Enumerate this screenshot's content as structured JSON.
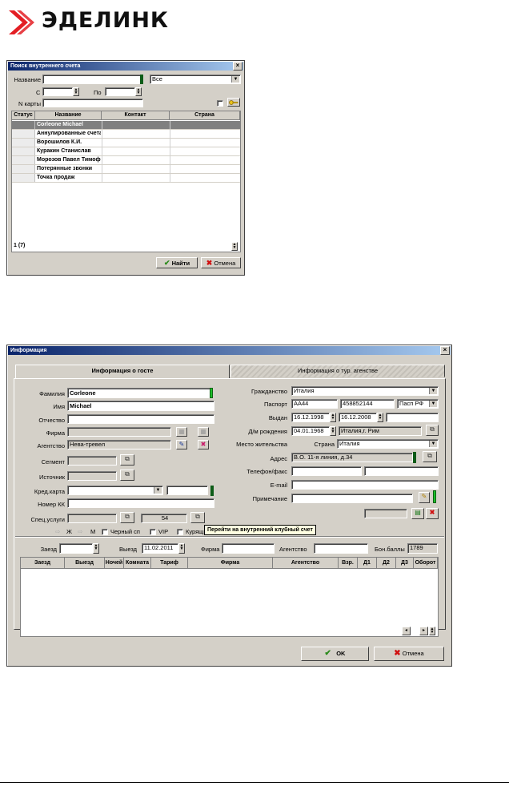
{
  "logo": {
    "text": "ЭДЕЛИНК"
  },
  "search": {
    "title": "Поиск внутреннего счета",
    "name_label": "Название",
    "name_value": "",
    "filter_value": "Все",
    "from_label": "С",
    "to_label": "По",
    "card_label": "N карты",
    "columns": [
      "Статус",
      "Название",
      "Контакт",
      "Страна"
    ],
    "rows": [
      "Corleone Michael",
      "Аннулированные счета",
      "Ворошилов К.И.",
      "Куракин Станислав",
      "Морозов Павел Тимоф",
      "Потерянные звонки",
      "Точка продаж"
    ],
    "status": "1 (7)",
    "find_label": "Найти",
    "cancel_label": "Отмена"
  },
  "info": {
    "title": "Информация",
    "tab_guest": "Информация о госте",
    "tab_agency": "Информация о тур. агенстве",
    "surname_label": "Фамилия",
    "surname": "Corleone",
    "name_label": "Имя",
    "name": "Michael",
    "patronymic_label": "Отчество",
    "firm_label": "Фирма",
    "agency_label": "Агентство",
    "agency": "Нева-тревел",
    "segment_label": "Сегмент",
    "source_label": "Источник",
    "card_label": "Кред.карта",
    "kk_label": "Номер КК",
    "services_label": "Спец.услуги",
    "services_count": "54",
    "gender_f": "Ж",
    "gender_m": "М",
    "blacklist_label": "Черный сп",
    "vip_label": "VIP",
    "smoker_label": "Курящий",
    "citizenship_label": "Гражданство",
    "citizenship": "Италия",
    "passport_label": "Паспорт",
    "passport_series": "AA44",
    "passport_number": "458852144",
    "passport_type": "Пасп РФ",
    "issued_label": "Выдан",
    "issued_from": "16.12.1998",
    "issued_to": "16.12.2008",
    "birth_label": "Д/м рождения",
    "birth_date": "04.01.1968",
    "birth_place": "Италия,г. Рим",
    "residence_label": "Место жительства",
    "country_label": "Страна",
    "country": "Италия",
    "address_label": "Адрес",
    "address": "В.О. 11-я линия, д.34",
    "phone_label": "Телефон/факс",
    "email_label": "E-mail",
    "note_label": "Примечание",
    "tooltip": "Перейти на внутренний клубный счет",
    "arrival_label": "Заезд",
    "departure_label": "Выезд",
    "departure": "11.02.2011",
    "firm2_label": "Фирма",
    "agency2_label": "Агентство",
    "bonus_label": "Бон.баллы",
    "bonus": "1789",
    "columns": [
      "Заезд",
      "Выезд",
      "Ночей",
      "Комната",
      "Тариф",
      "Фирма",
      "Агентство",
      "Взр.",
      "Д1",
      "Д2",
      "Д3",
      "Оборот"
    ],
    "ok_label": "OK",
    "cancel_label": "Отмена"
  }
}
